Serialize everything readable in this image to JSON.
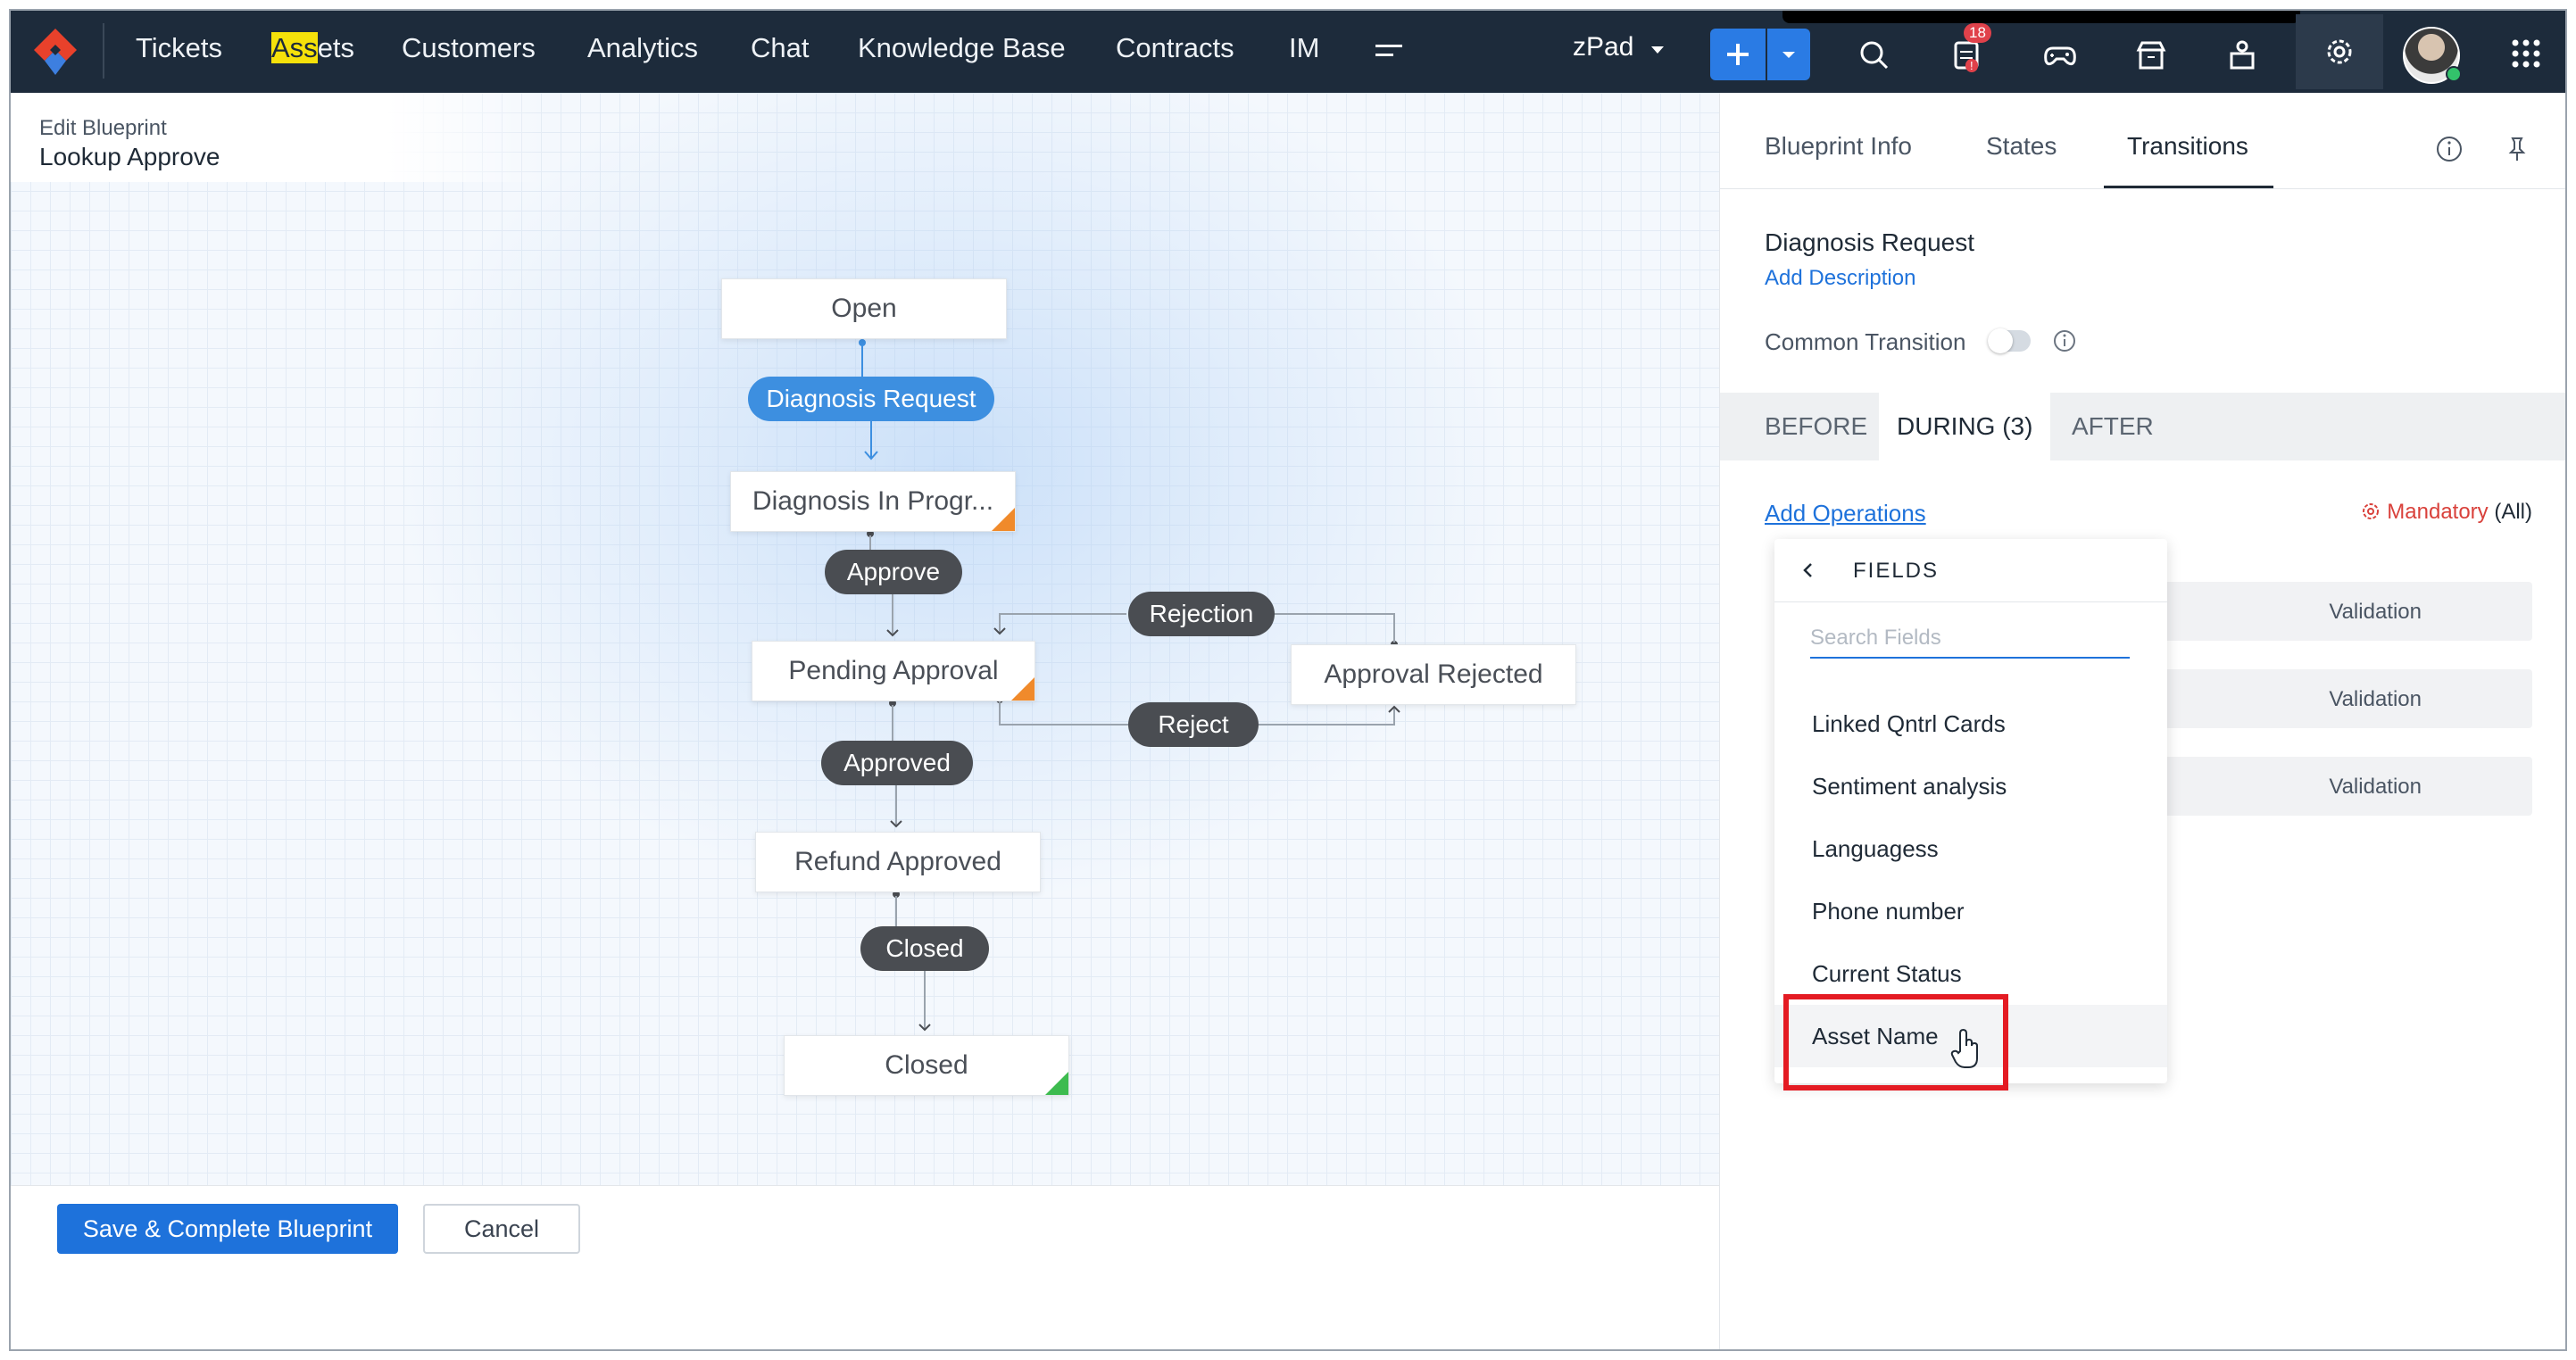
{
  "nav": {
    "items": [
      {
        "label": "Tickets"
      },
      {
        "label_highlight": "Ass",
        "label_rest": "ets"
      },
      {
        "label": "Customers"
      },
      {
        "label": "Analytics"
      },
      {
        "label": "Chat"
      },
      {
        "label": "Knowledge Base"
      },
      {
        "label": "Contracts"
      },
      {
        "label": "IM"
      }
    ],
    "workspace": "zPad",
    "notification_count": "18",
    "notification_sub": "!"
  },
  "blueprint": {
    "edit_label": "Edit Blueprint",
    "name": "Lookup Approve"
  },
  "flow": {
    "states": {
      "open": "Open",
      "diagnosis_in_progress": "Diagnosis In Progr...",
      "pending_approval": "Pending Approval",
      "approval_rejected": "Approval Rejected",
      "refund_approved": "Refund Approved",
      "closed": "Closed"
    },
    "transitions": {
      "diagnosis_request": "Diagnosis Request",
      "approve": "Approve",
      "rejection": "Rejection",
      "reject": "Reject",
      "approved": "Approved",
      "closed": "Closed"
    }
  },
  "footer": {
    "save_label": "Save & Complete Blueprint",
    "cancel_label": "Cancel"
  },
  "panel": {
    "tabs": [
      "Blueprint Info",
      "States",
      "Transitions"
    ],
    "transition_name": "Diagnosis Request",
    "add_description": "Add Description",
    "common_transition": "Common Transition",
    "stages": [
      "BEFORE",
      "DURING (3)",
      "AFTER"
    ],
    "add_operations": "Add Operations",
    "mandatory": "Mandatory",
    "mandatory_scope": "(All)",
    "operations": [
      "Validation",
      "Validation",
      "Validation"
    ]
  },
  "fields_dropdown": {
    "title": "FIELDS",
    "search_placeholder": "Search Fields",
    "items": [
      "Linked Qntrl Cards",
      "Sentiment analysis",
      "Languagess",
      "Phone number",
      "Current Status",
      "Asset Name"
    ]
  },
  "colors": {
    "nav_bg": "#1d2b3b",
    "accent": "#1e72db",
    "transition_active": "#3d8fe0",
    "transition_pill": "#4a4d52",
    "mandatory": "#d9413b",
    "highlight_box": "#e41b23"
  }
}
